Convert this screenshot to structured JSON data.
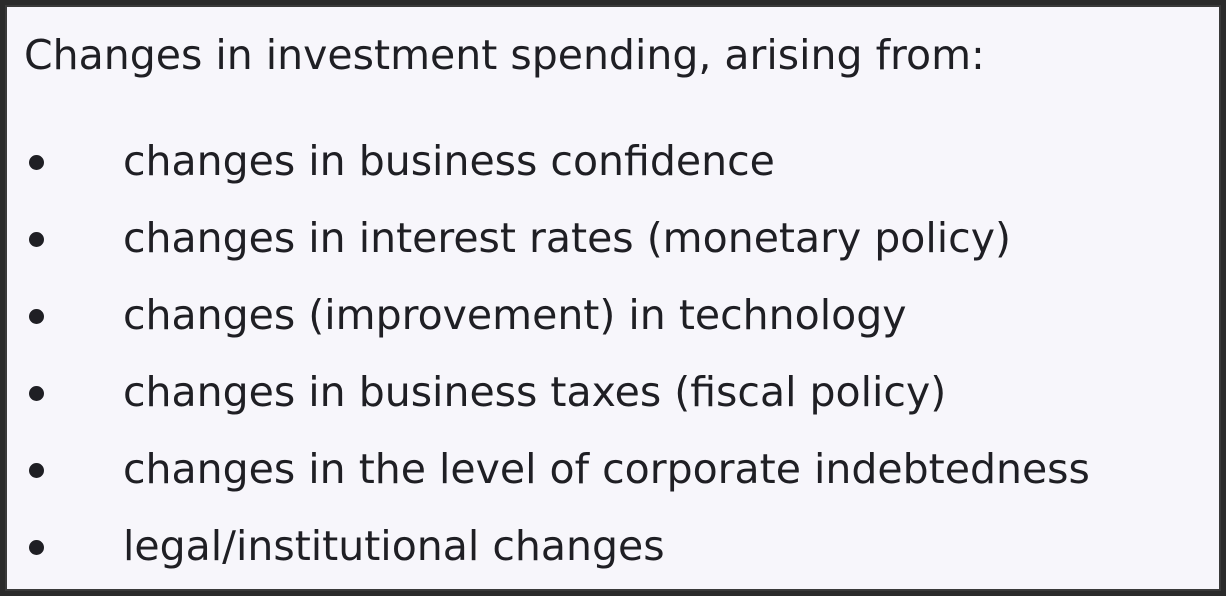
{
  "heading": "Changes in investment spending, arising from:",
  "items": [
    {
      "label": "changes in business confidence"
    },
    {
      "label": "changes in interest rates (monetary policy)"
    },
    {
      "label": "changes (improvement) in technology"
    },
    {
      "label": "changes in business taxes (fiscal policy)"
    },
    {
      "label": "changes in the level of corporate indebtedness"
    },
    {
      "label": "legal/institutional changes"
    }
  ]
}
